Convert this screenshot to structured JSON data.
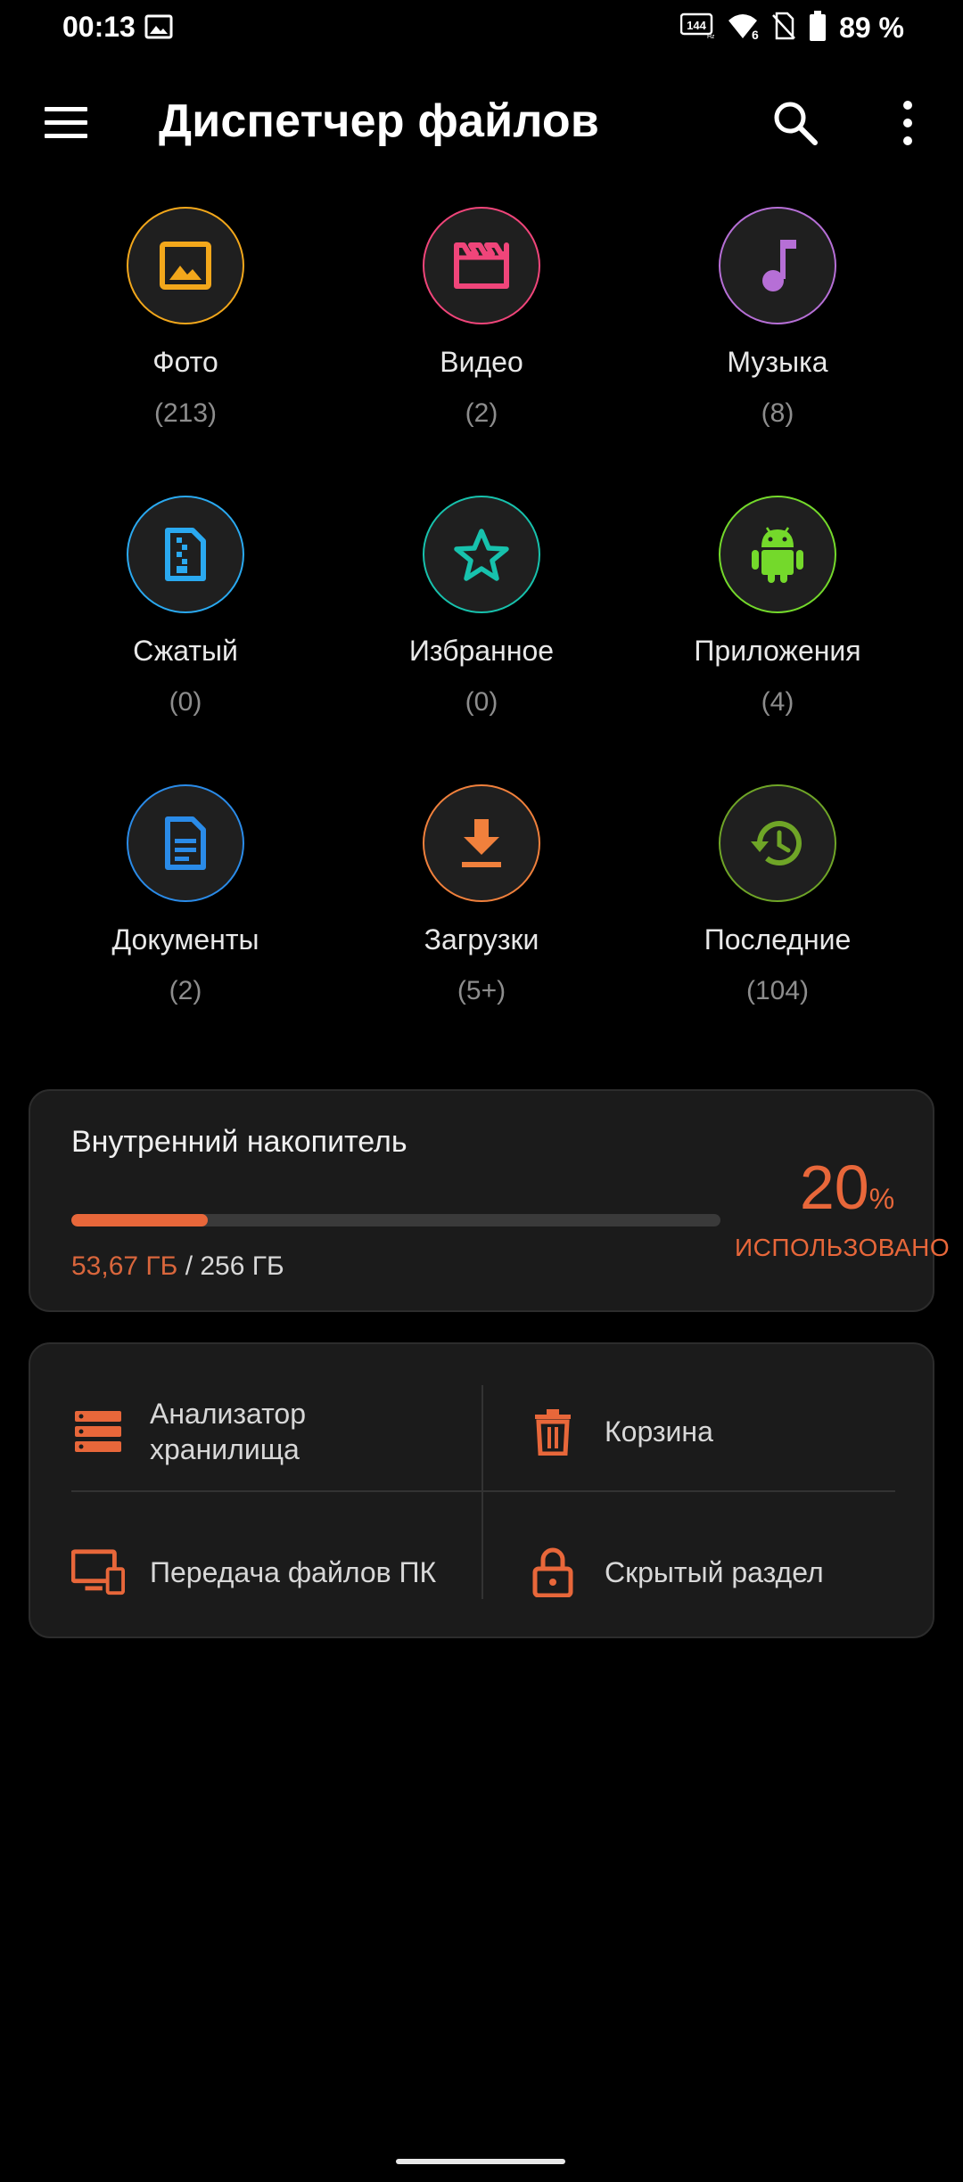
{
  "status_bar": {
    "time": "00:13",
    "refresh_badge": "144",
    "signal_badge": "6",
    "battery_percent": "89 %",
    "icons": [
      "image-icon",
      "refresh-rate-icon",
      "wifi-icon",
      "no-sim-icon",
      "battery-icon"
    ]
  },
  "app_bar": {
    "title": "Диспетчер файлов",
    "icons": [
      "menu-icon",
      "search-icon",
      "more-vert-icon"
    ]
  },
  "categories": [
    {
      "label": "Фото",
      "count": "(213)",
      "color": "#f2a71b",
      "icon": "image-icon"
    },
    {
      "label": "Видео",
      "count": "(2)",
      "color": "#f0457a",
      "icon": "clapperboard-icon"
    },
    {
      "label": "Музыка",
      "count": "(8)",
      "color": "#b66fd6",
      "icon": "music-note-icon"
    },
    {
      "label": "Сжатый",
      "count": "(0)",
      "color": "#2aa9f0",
      "icon": "zip-file-icon"
    },
    {
      "label": "Избранное",
      "count": "(0)",
      "color": "#17c2ad",
      "icon": "star-icon"
    },
    {
      "label": "Приложения",
      "count": "(4)",
      "color": "#74d92b",
      "icon": "android-icon"
    },
    {
      "label": "Документы",
      "count": "(2)",
      "color": "#2a8be8",
      "icon": "document-icon"
    },
    {
      "label": "Загрузки",
      "count": "(5+)",
      "color": "#f0803c",
      "icon": "download-icon"
    },
    {
      "label": "Последние",
      "count": "(104)",
      "color": "#6fa527",
      "icon": "history-icon"
    }
  ],
  "storage": {
    "title": "Внутренний накопитель",
    "used": "53,67 ГБ",
    "total": "/ 256 ГБ",
    "percent": "20",
    "percent_sign": "%",
    "used_fraction": 0.21,
    "caption": "ИСПОЛЬЗОВАНО",
    "accent": "#e8673a"
  },
  "tools": [
    {
      "label": "Анализатор хранилища",
      "icon": "storage-analyzer-icon"
    },
    {
      "label": "Корзина",
      "icon": "trash-icon"
    },
    {
      "label": "Передача файлов ПК",
      "icon": "pc-transfer-icon"
    },
    {
      "label": "Скрытый раздел",
      "icon": "lock-icon"
    }
  ]
}
